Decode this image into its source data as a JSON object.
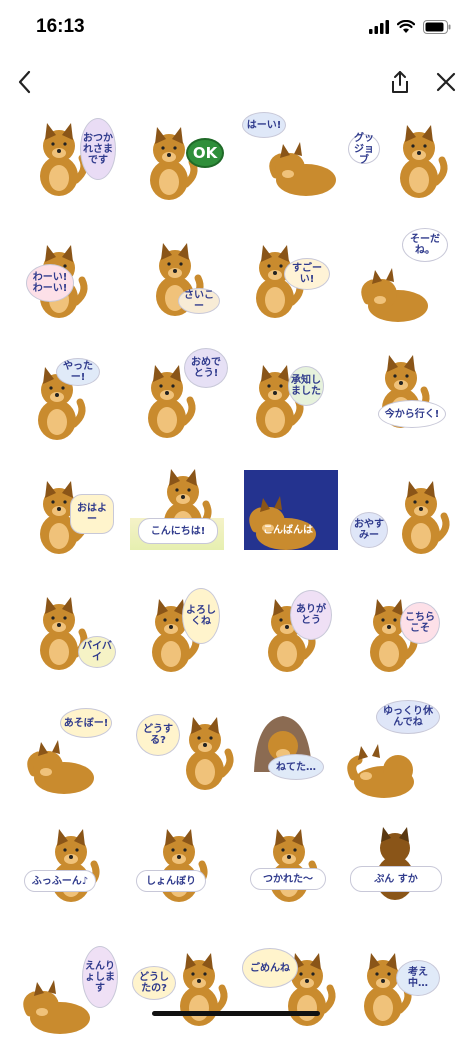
{
  "status": {
    "time": "16:13"
  },
  "nav": {
    "back_icon": "chevron-left-icon",
    "share_icon": "share-icon",
    "close_icon": "close-icon"
  },
  "stickers": [
    {
      "text": "おつかれさまです",
      "bubble": "#e9dcf5",
      "pose": "sit"
    },
    {
      "text": "OK",
      "bubble": "#2f8f3a",
      "pose": "sit"
    },
    {
      "text": "はーい!",
      "bubble": "#dfe8f8",
      "pose": "lie"
    },
    {
      "text": "グッジョブ",
      "bubble": "#ffffff",
      "pose": "sit"
    },
    {
      "text": "わーい!わーい!",
      "bubble": "#fde0e8",
      "pose": "jump"
    },
    {
      "text": "さいこー",
      "bubble": "#f8ecd6",
      "pose": "run"
    },
    {
      "text": "すごーい!",
      "bubble": "#fff3d6",
      "pose": "sit"
    },
    {
      "text": "そーだね。",
      "bubble": "#ffffff",
      "pose": "lie"
    },
    {
      "text": "やったー!",
      "bubble": "#e0eaf8",
      "pose": "jump"
    },
    {
      "text": "おめでとう!",
      "bubble": "#e6e0f5",
      "pose": "sit"
    },
    {
      "text": "承知しました",
      "bubble": "#e6f2dc",
      "pose": "sit"
    },
    {
      "text": "今から行く!",
      "bubble": "#ffffff",
      "pose": "run"
    },
    {
      "text": "おはよー",
      "bubble": "#fff4cc",
      "pose": "sit"
    },
    {
      "text": "こんにちは!",
      "bubble": "#ffffff",
      "pose": "sit"
    },
    {
      "text": "こんばんは",
      "bubble": "#24338f",
      "pose": "lie"
    },
    {
      "text": "おやすみー",
      "bubble": "#dfe6f8",
      "pose": "sit"
    },
    {
      "text": "バイバイ",
      "bubble": "#f6f3c6",
      "pose": "wave"
    },
    {
      "text": "よろしくね",
      "bubble": "#fff4cc",
      "pose": "sit"
    },
    {
      "text": "ありがとう",
      "bubble": "#efe0f5",
      "pose": "sit"
    },
    {
      "text": "こちらこそ",
      "bubble": "#fde0e8",
      "pose": "sit"
    },
    {
      "text": "あそぼー!",
      "bubble": "#fff4cc",
      "pose": "lie"
    },
    {
      "text": "どうする?",
      "bubble": "#fff4cc",
      "pose": "stand"
    },
    {
      "text": "ねてた…",
      "bubble": "#e0eaf8",
      "pose": "blanket"
    },
    {
      "text": "ゆっくり休んでね",
      "bubble": "#dfe6f8",
      "pose": "sleep"
    },
    {
      "text": "ふっふーん♪",
      "bubble": "#ffffff",
      "pose": "sit"
    },
    {
      "text": "しょんぼり",
      "bubble": "#ffffff",
      "pose": "sit"
    },
    {
      "text": "つかれた〜",
      "bubble": "#ffffff",
      "pose": "sit"
    },
    {
      "text": "ぷん すか",
      "bubble": "#ffffff",
      "pose": "back"
    },
    {
      "text": "えんりょします",
      "bubble": "#efe0f5",
      "pose": "lie"
    },
    {
      "text": "どうしたの?",
      "bubble": "#fff4cc",
      "pose": "sit"
    },
    {
      "text": "ごめんね",
      "bubble": "#fff4cc",
      "pose": "sit"
    },
    {
      "text": "考え中…",
      "bubble": "#e0eaf8",
      "pose": "sit"
    }
  ]
}
